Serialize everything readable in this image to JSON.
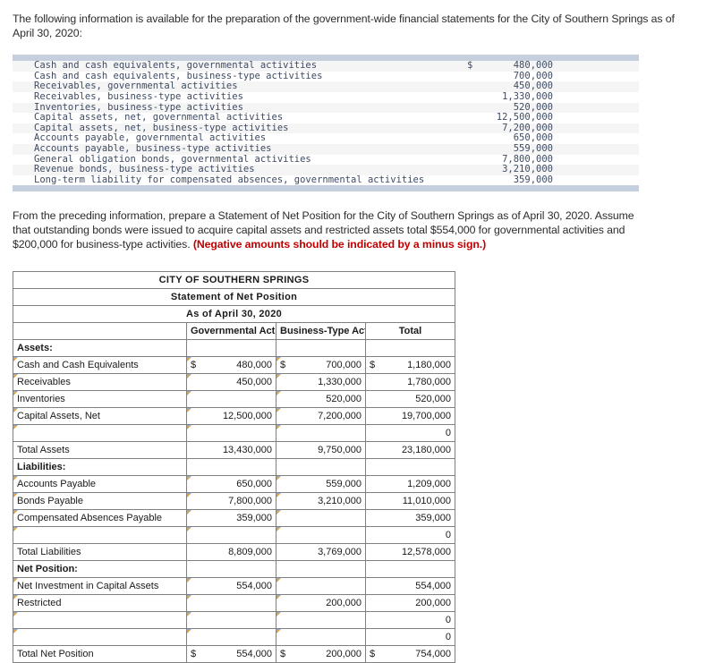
{
  "intro": {
    "text": "The following information is available for the preparation of the government-wide financial statements for the City of Southern Springs as of April 30, 2020:"
  },
  "given_data": {
    "rows": [
      {
        "label": "Cash and cash equivalents, governmental activities",
        "currency": "$",
        "value": "480,000"
      },
      {
        "label": "Cash and cash equivalents, business-type activities",
        "currency": "",
        "value": "700,000"
      },
      {
        "label": "Receivables, governmental activities",
        "currency": "",
        "value": "450,000"
      },
      {
        "label": "Receivables, business-type activities",
        "currency": "",
        "value": "1,330,000"
      },
      {
        "label": "Inventories, business-type activities",
        "currency": "",
        "value": "520,000"
      },
      {
        "label": "Capital assets, net, governmental activities",
        "currency": "",
        "value": "12,500,000"
      },
      {
        "label": "Capital assets, net, business-type activities",
        "currency": "",
        "value": "7,200,000"
      },
      {
        "label": "Accounts payable, governmental activities",
        "currency": "",
        "value": "650,000"
      },
      {
        "label": "Accounts payable, business-type activities",
        "currency": "",
        "value": "559,000"
      },
      {
        "label": "General obligation bonds, governmental activities",
        "currency": "",
        "value": "7,800,000"
      },
      {
        "label": "Revenue bonds, business-type activities",
        "currency": "",
        "value": "3,210,000"
      },
      {
        "label": "Long-term liability for compensated absences, governmental activities",
        "currency": "",
        "value": "359,000"
      }
    ]
  },
  "task": {
    "body": "From the preceding information, prepare a Statement of Net Position for the City of Southern Springs as of April 30, 2020. Assume that outstanding bonds were issued to acquire capital assets and restricted assets total $554,000 for governmental activities and $200,000 for business-type activities. ",
    "warning": "(Negative amounts should be indicated by a minus sign.)"
  },
  "worksheet": {
    "title_line1": "CITY OF SOUTHERN SPRINGS",
    "title_line2": "Statement of Net Position",
    "title_line3": "As of April 30, 2020",
    "columns": {
      "label": "",
      "governmental": "Governmental Activities",
      "business": "Business-Type Activities",
      "total": "Total"
    },
    "sections": [
      {
        "heading": "Assets:",
        "rows": [
          {
            "label": "Cash and Cash Equivalents",
            "gov_cur": "$",
            "gov": "480,000",
            "bus_cur": "$",
            "bus": "700,000",
            "tot_cur": "$",
            "tot": "1,180,000"
          },
          {
            "label": "Receivables",
            "gov_cur": "",
            "gov": "450,000",
            "bus_cur": "",
            "bus": "1,330,000",
            "tot_cur": "",
            "tot": "1,780,000"
          },
          {
            "label": "Inventories",
            "gov_cur": "",
            "gov": "",
            "bus_cur": "",
            "bus": "520,000",
            "tot_cur": "",
            "tot": "520,000"
          },
          {
            "label": "Capital Assets, Net",
            "gov_cur": "",
            "gov": "12,500,000",
            "bus_cur": "",
            "bus": "7,200,000",
            "tot_cur": "",
            "tot": "19,700,000"
          },
          {
            "label": "",
            "gov_cur": "",
            "gov": "",
            "bus_cur": "",
            "bus": "",
            "tot_cur": "",
            "tot": "0"
          }
        ],
        "total": {
          "label": "Total Assets",
          "gov": "13,430,000",
          "bus": "9,750,000",
          "tot": "23,180,000"
        }
      },
      {
        "heading": "Liabilities:",
        "rows": [
          {
            "label": "Accounts Payable",
            "gov_cur": "",
            "gov": "650,000",
            "bus_cur": "",
            "bus": "559,000",
            "tot_cur": "",
            "tot": "1,209,000"
          },
          {
            "label": "Bonds Payable",
            "gov_cur": "",
            "gov": "7,800,000",
            "bus_cur": "",
            "bus": "3,210,000",
            "tot_cur": "",
            "tot": "11,010,000"
          },
          {
            "label": "Compensated Absences Payable",
            "gov_cur": "",
            "gov": "359,000",
            "bus_cur": "",
            "bus": "",
            "tot_cur": "",
            "tot": "359,000"
          },
          {
            "label": "",
            "gov_cur": "",
            "gov": "",
            "bus_cur": "",
            "bus": "",
            "tot_cur": "",
            "tot": "0"
          }
        ],
        "total": {
          "label": "Total Liabilities",
          "gov": "8,809,000",
          "bus": "3,769,000",
          "tot": "12,578,000"
        }
      },
      {
        "heading": "Net Position:",
        "rows": [
          {
            "label": "Net Investment in Capital Assets",
            "gov_cur": "",
            "gov": "554,000",
            "bus_cur": "",
            "bus": "",
            "tot_cur": "",
            "tot": "554,000"
          },
          {
            "label": "Restricted",
            "gov_cur": "",
            "gov": "",
            "bus_cur": "",
            "bus": "200,000",
            "tot_cur": "",
            "tot": "200,000"
          },
          {
            "label": "",
            "gov_cur": "",
            "gov": "",
            "bus_cur": "",
            "bus": "",
            "tot_cur": "",
            "tot": "0"
          },
          {
            "label": "",
            "gov_cur": "",
            "gov": "",
            "bus_cur": "",
            "bus": "",
            "tot_cur": "",
            "tot": "0"
          }
        ],
        "total": {
          "label": "Total Net Position",
          "gov_cur": "$",
          "gov": "554,000",
          "bus_cur": "$",
          "bus": "200,000",
          "tot_cur": "$",
          "tot": "754,000"
        }
      }
    ]
  },
  "colors": {
    "header_blue": "#72a7e0",
    "entry_border": "#7ba7d7",
    "entry_marker": "#e6a33c",
    "warning_red": "#c00000",
    "data_block_band": "#c6cfdd"
  }
}
